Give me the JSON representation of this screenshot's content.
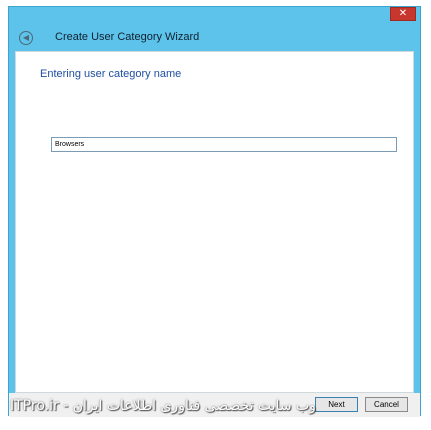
{
  "window": {
    "title": "Create User Category Wizard",
    "close_glyph": "✕",
    "back_glyph": "◀"
  },
  "content": {
    "heading": "Entering user category name",
    "name_value": "Browsers"
  },
  "footer": {
    "next_label": "Next",
    "cancel_label": "Cancel"
  },
  "watermark": {
    "text": "وب سایت تخصصی فناوری اطلاعات ایران - ITPro.ir"
  },
  "colors": {
    "titlebar": "#5ec3ea",
    "heading": "#1f4fa0",
    "close": "#c8372d"
  }
}
